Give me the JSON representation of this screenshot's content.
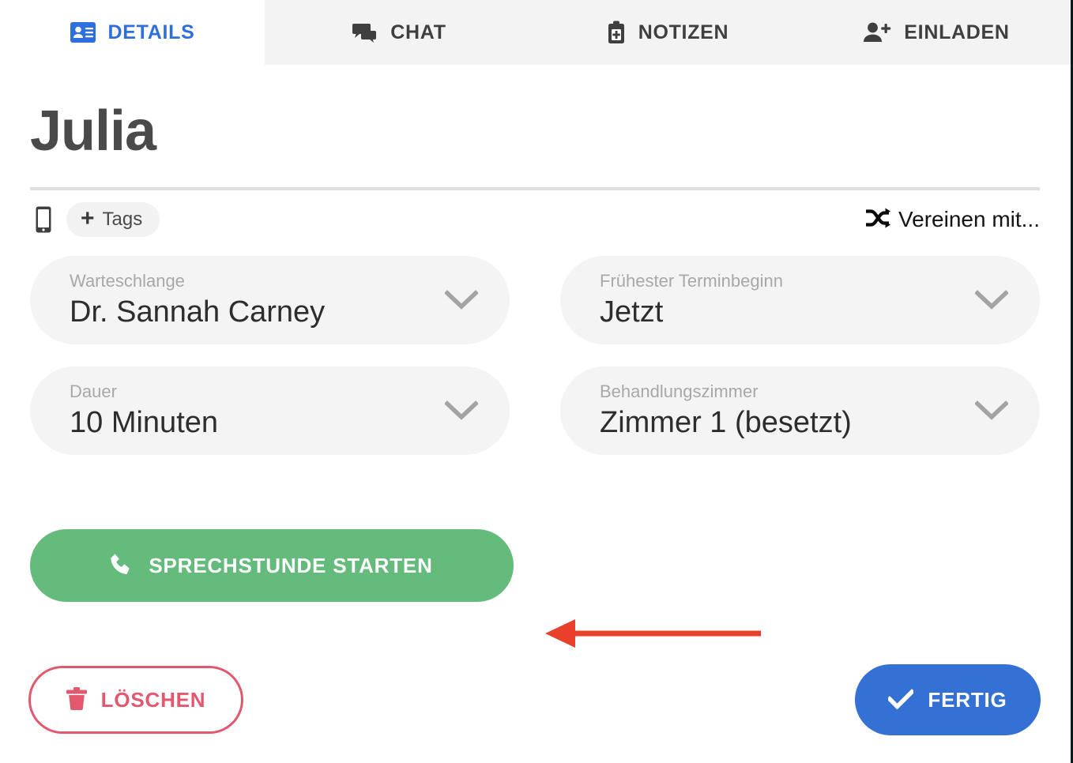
{
  "tabs": [
    {
      "label": "DETAILS",
      "icon": "contact-card-icon",
      "active": true
    },
    {
      "label": "CHAT",
      "icon": "chat-bubbles-icon",
      "active": false
    },
    {
      "label": "NOTIZEN",
      "icon": "clipboard-medical-icon",
      "active": false
    },
    {
      "label": "EINLADEN",
      "icon": "person-add-icon",
      "active": false
    }
  ],
  "patient": {
    "name": "Julia",
    "phone_icon": "smartphone-icon",
    "tags_button": {
      "plus": "+",
      "label": "Tags"
    },
    "merge": {
      "icon": "shuffle-merge-icon",
      "label": "Vereinen mit..."
    }
  },
  "fields": [
    {
      "label": "Warteschlange",
      "value": "Dr. Sannah Carney",
      "icon": "chevron-down-icon"
    },
    {
      "label": "Frühester Terminbeginn",
      "value": "Jetzt",
      "icon": "chevron-down-icon"
    },
    {
      "label": "Dauer",
      "value": "10 Minuten",
      "icon": "chevron-down-icon"
    },
    {
      "label": "Behandlungszimmer",
      "value": "Zimmer 1 (besetzt)",
      "icon": "chevron-down-icon"
    }
  ],
  "actions": {
    "start": {
      "label": "SPRECHSTUNDE STARTEN",
      "icon": "phone-icon"
    },
    "delete": {
      "label": "LÖSCHEN",
      "icon": "trash-icon"
    },
    "done": {
      "label": "FERTIG",
      "icon": "check-icon"
    }
  },
  "annotation": {
    "type": "arrow-left",
    "points_to": "SPRECHSTUNDE STARTEN"
  },
  "colors": {
    "tab_active_text": "#2f6fdd",
    "tab_inactive_text": "#3f3f3f",
    "tabbar_bg": "#f3f3f3",
    "title_text": "#4a4a4a",
    "field_bg": "#f4f4f4",
    "field_label": "#a8a8a8",
    "field_value": "#2d2d2d",
    "start_button": "#64bb7b",
    "delete_accent": "#e2596f",
    "done_button": "#3570d4",
    "annotation_arrow": "#e8402a"
  }
}
